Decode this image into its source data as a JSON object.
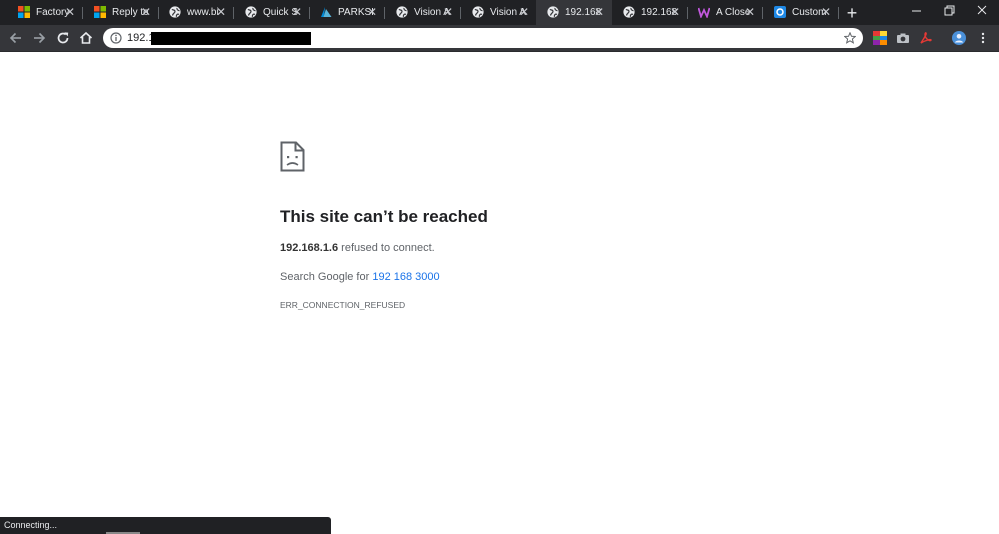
{
  "tabs": [
    {
      "title": "Factory",
      "icon": "microsoft-logo-icon",
      "active": false
    },
    {
      "title": "Reply to",
      "icon": "microsoft-logo-icon",
      "active": false
    },
    {
      "title": "www.bi",
      "icon": "globe-icon",
      "active": false
    },
    {
      "title": "Quick S",
      "icon": "globe-icon",
      "active": false
    },
    {
      "title": "PARKSI",
      "icon": "azure-logo-icon",
      "active": false
    },
    {
      "title": "Vision A",
      "icon": "globe-icon",
      "active": false
    },
    {
      "title": "Vision A",
      "icon": "globe-icon",
      "active": false
    },
    {
      "title": "192.168",
      "icon": "globe-icon",
      "active": true
    },
    {
      "title": "192.168",
      "icon": "globe-icon",
      "active": false
    },
    {
      "title": "A Close",
      "icon": "w-logo-icon",
      "active": false
    },
    {
      "title": "Custom",
      "icon": "vision-logo-icon",
      "active": false
    }
  ],
  "toolbar": {
    "url": "192.168.1"
  },
  "error": {
    "title": "This site can’t be reached",
    "host": "192.168.1.6",
    "detail": " refused to connect.",
    "search_prefix": "Search Google for ",
    "search_query": "192 168 3000",
    "code": "ERR_CONNECTION_REFUSED"
  },
  "status_text": "Connecting...",
  "colors": {
    "tabstrip": "#202124",
    "toolbar": "#35363a",
    "link": "#1a73e8"
  }
}
